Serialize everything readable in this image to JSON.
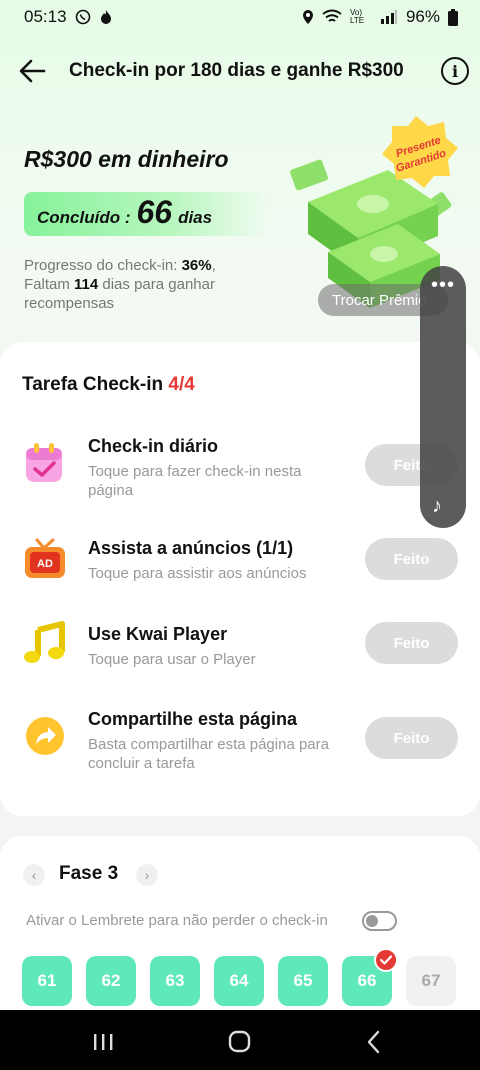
{
  "status_bar": {
    "time": "05:13",
    "battery": "96%",
    "net": "Vo) LTE"
  },
  "header": {
    "title": "Check-in por 180 dias e ganhe R$300"
  },
  "hero": {
    "reward_title": "R$300 em dinheiro",
    "completed_label": "Concluído :",
    "completed_days": "66",
    "days_unit": "dias",
    "progress_label": "Progresso do check-in: ",
    "progress_percent": "36%",
    "remaining_prefix": "Faltam ",
    "remaining_days": "114",
    "remaining_suffix": " dias para ganhar recompensas",
    "badge_line1": "Presente",
    "badge_line2": "Garantido",
    "exchange_button": "Trocar Prêmio"
  },
  "tasks": {
    "heading": "Tarefa Check-in ",
    "count": "4/4",
    "items": [
      {
        "title": "Check-in diário",
        "desc": "Toque para fazer check-in nesta página",
        "button": "Feito",
        "icon": "calendar-check-icon"
      },
      {
        "title": "Assista a anúncios  (1/1)",
        "desc": "Toque para assistir aos anúncios",
        "button": "Feito",
        "icon": "ad-tv-icon"
      },
      {
        "title": "Use Kwai Player",
        "desc": "Toque para usar o Player",
        "button": "Feito",
        "icon": "music-note-icon"
      },
      {
        "title": "Compartilhe esta página",
        "desc": "Basta compartilhar esta página para concluir a tarefa",
        "button": "Feito",
        "icon": "share-arrow-icon"
      }
    ]
  },
  "phase": {
    "title": "Fase 3",
    "reminder": "Ativar o Lembrete para não perder o check-in",
    "reminder_enabled": false,
    "days": [
      "61",
      "62",
      "63",
      "64",
      "65",
      "66",
      "67"
    ],
    "checked_day": "66"
  },
  "colors": {
    "accent_green": "#5fe8b9",
    "accent_red": "#e53935",
    "done_button": "#dcdcdc"
  }
}
